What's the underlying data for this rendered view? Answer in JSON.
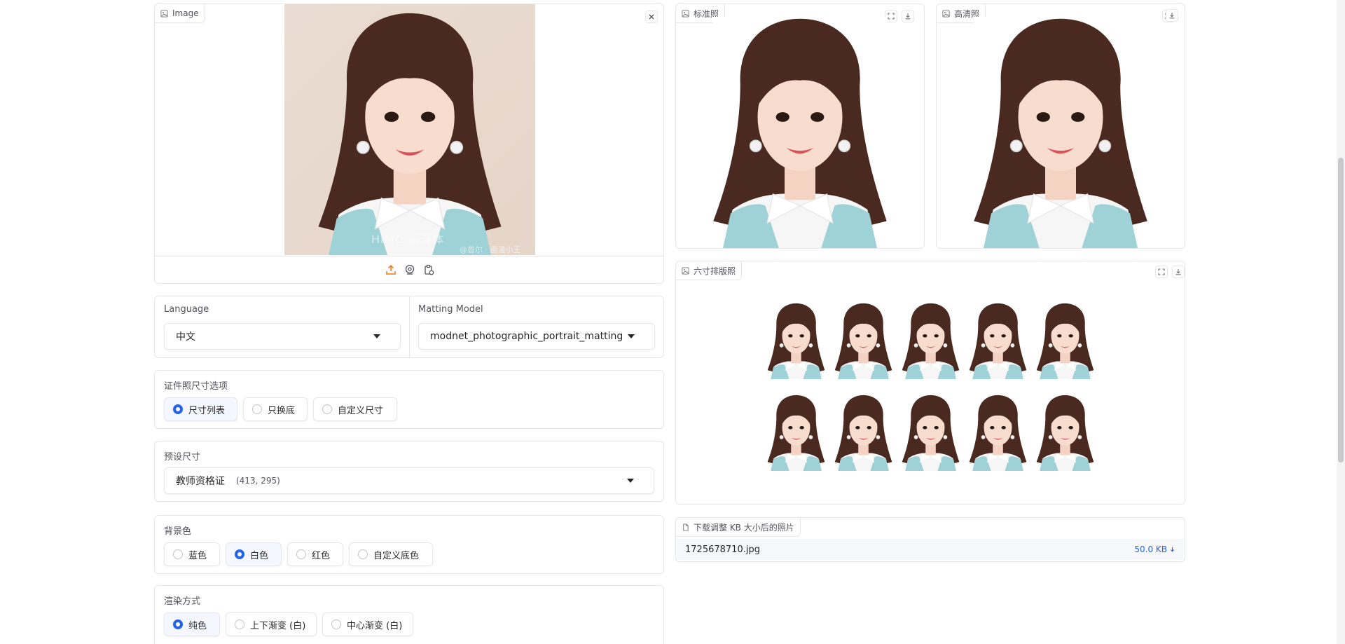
{
  "input_image": {
    "label": "Image",
    "close_icon": "close-icon"
  },
  "toolbar_icons": [
    "upload-icon",
    "webcam-icon",
    "clipboard-icon"
  ],
  "outputs": {
    "standard": {
      "label": "标准照"
    },
    "hd": {
      "label": "高清照"
    },
    "layout": {
      "label": "六寸排版照"
    },
    "download": {
      "label": "下载调整 KB 大小后的照片",
      "filename": "1725678710.jpg",
      "size": "50.0 KB"
    }
  },
  "language": {
    "label": "Language",
    "value": "中文"
  },
  "matting": {
    "label": "Matting Model",
    "value": "modnet_photographic_portrait_matting"
  },
  "size_option": {
    "label": "证件照尺寸选项",
    "options": [
      "尺寸列表",
      "只换底",
      "自定义尺寸"
    ],
    "selected": 0
  },
  "preset": {
    "label": "预设尺寸",
    "name": "教师资格证",
    "dims": "(413, 295)"
  },
  "bg_color": {
    "label": "背景色",
    "options": [
      "蓝色",
      "白色",
      "红色",
      "自定义底色"
    ],
    "selected": 1
  },
  "render": {
    "label": "渲染方式",
    "options": [
      "纯色",
      "上下渐变 (白)",
      "中心渐变 (白)"
    ],
    "selected": 0
  },
  "watermark": {
    "text": "HIMO 画漫体",
    "credit": "@首尔 · 画漫小王"
  },
  "colors": {
    "accent": "#2563eb",
    "upload": "#f97316",
    "download_size": "#2563eb"
  }
}
